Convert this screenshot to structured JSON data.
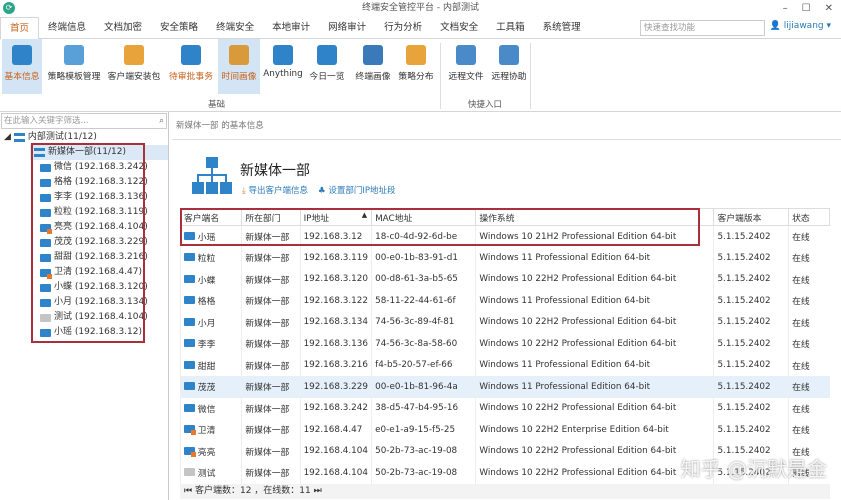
{
  "app": {
    "title": "终端安全管控平台 - 内部测试",
    "user": "lijiawang",
    "search_placeholder": "快速查找功能"
  },
  "tabs": [
    "首页",
    "终端信息",
    "文档加密",
    "安全策略",
    "终端安全",
    "本地审计",
    "网络审计",
    "行为分析",
    "文档安全",
    "工具箱",
    "系统管理"
  ],
  "ribbon": {
    "buttons": [
      "基本信息",
      "策略模板管理",
      "客户端安装包",
      "待审批事务",
      "时间画像",
      "Anything",
      "今日一览",
      "终端画像",
      "策略分布",
      "远程文件",
      "远程协助"
    ],
    "groups": [
      "基础",
      "快捷入口"
    ]
  },
  "tree": {
    "filter_placeholder": "在此输入关键字筛选...",
    "root": "内部测试(11/12)",
    "dept": "新媒体一部(11/12)",
    "items": [
      {
        "label": "微信 (192.168.3.242)",
        "s": ""
      },
      {
        "label": "格格 (192.168.3.122)",
        "s": ""
      },
      {
        "label": "李李 (192.168.3.136)",
        "s": ""
      },
      {
        "label": "粒粒 (192.168.3.119)",
        "s": ""
      },
      {
        "label": "亮亮 (192.168.4.104)",
        "s": "warn"
      },
      {
        "label": "茂茂 (192.168.3.229)",
        "s": ""
      },
      {
        "label": "甜甜 (192.168.3.216)",
        "s": ""
      },
      {
        "label": "卫清 (192.168.4.47)",
        "s": "warn"
      },
      {
        "label": "小蝶 (192.168.3.120)",
        "s": ""
      },
      {
        "label": "小月 (192.168.3.134)",
        "s": ""
      },
      {
        "label": "测试 (192.168.4.104)",
        "s": "off"
      },
      {
        "label": "小瑶 (192.168.3.12)",
        "s": ""
      }
    ]
  },
  "main": {
    "breadcrumb": "新媒体一部 的基本信息",
    "dept_name": "新媒体一部",
    "export_link": "导出客户端信息",
    "ip_link": "设置部门IP地址段",
    "columns": [
      "客户端名",
      "所在部门",
      "IP地址",
      "MAC地址",
      "操作系统",
      "客户端版本",
      "状态"
    ],
    "rows": [
      [
        "小瑶",
        "新媒体一部",
        "192.168.3.12",
        "18-c0-4d-92-6d-be",
        "Windows 10 21H2 Professional Edition 64-bit",
        "5.1.15.2402",
        "在线",
        ""
      ],
      [
        "粒粒",
        "新媒体一部",
        "192.168.3.119",
        "00-e0-1b-83-91-d1",
        "Windows 11 Professional Edition 64-bit",
        "5.1.15.2402",
        "在线",
        ""
      ],
      [
        "小蝶",
        "新媒体一部",
        "192.168.3.120",
        "00-d8-61-3a-b5-65",
        "Windows 10 22H2 Professional Edition 64-bit",
        "5.1.15.2402",
        "在线",
        ""
      ],
      [
        "格格",
        "新媒体一部",
        "192.168.3.122",
        "58-11-22-44-61-6f",
        "Windows 11 Professional Edition 64-bit",
        "5.1.15.2402",
        "在线",
        ""
      ],
      [
        "小月",
        "新媒体一部",
        "192.168.3.134",
        "74-56-3c-89-4f-81",
        "Windows 10 22H2 Professional Edition 64-bit",
        "5.1.15.2402",
        "在线",
        ""
      ],
      [
        "李李",
        "新媒体一部",
        "192.168.3.136",
        "74-56-3c-8a-58-60",
        "Windows 10 22H2 Professional Edition 64-bit",
        "5.1.15.2402",
        "在线",
        ""
      ],
      [
        "甜甜",
        "新媒体一部",
        "192.168.3.216",
        "f4-b5-20-57-ef-66",
        "Windows 11 Professional Edition 64-bit",
        "5.1.15.2402",
        "在线",
        ""
      ],
      [
        "茂茂",
        "新媒体一部",
        "192.168.3.229",
        "00-e0-1b-81-96-4a",
        "Windows 11 Professional Edition 64-bit",
        "5.1.15.2402",
        "在线",
        "hl"
      ],
      [
        "微信",
        "新媒体一部",
        "192.168.3.242",
        "38-d5-47-b4-95-16",
        "Windows 10 22H2 Professional Edition 64-bit",
        "5.1.15.2402",
        "在线",
        ""
      ],
      [
        "卫清",
        "新媒体一部",
        "192.168.4.47",
        "e0-e1-a9-15-f5-25",
        "Windows 10 22H2 Enterprise Edition 64-bit",
        "5.1.15.2402",
        "在线",
        "warn"
      ],
      [
        "亮亮",
        "新媒体一部",
        "192.168.4.104",
        "50-2b-73-ac-19-08",
        "Windows 10 22H2 Professional Edition 64-bit",
        "5.1.15.2402",
        "在线",
        "warn"
      ],
      [
        "测试",
        "新媒体一部",
        "192.168.4.104",
        "50-2b-73-ac-19-08",
        "Windows 10 22H2 Professional Edition 64-bit",
        "5.1.15.2402",
        "离线",
        "off"
      ]
    ],
    "status_text": "客户端数：12 ，在线数：11"
  },
  "watermark": "知乎 @沉默是金"
}
